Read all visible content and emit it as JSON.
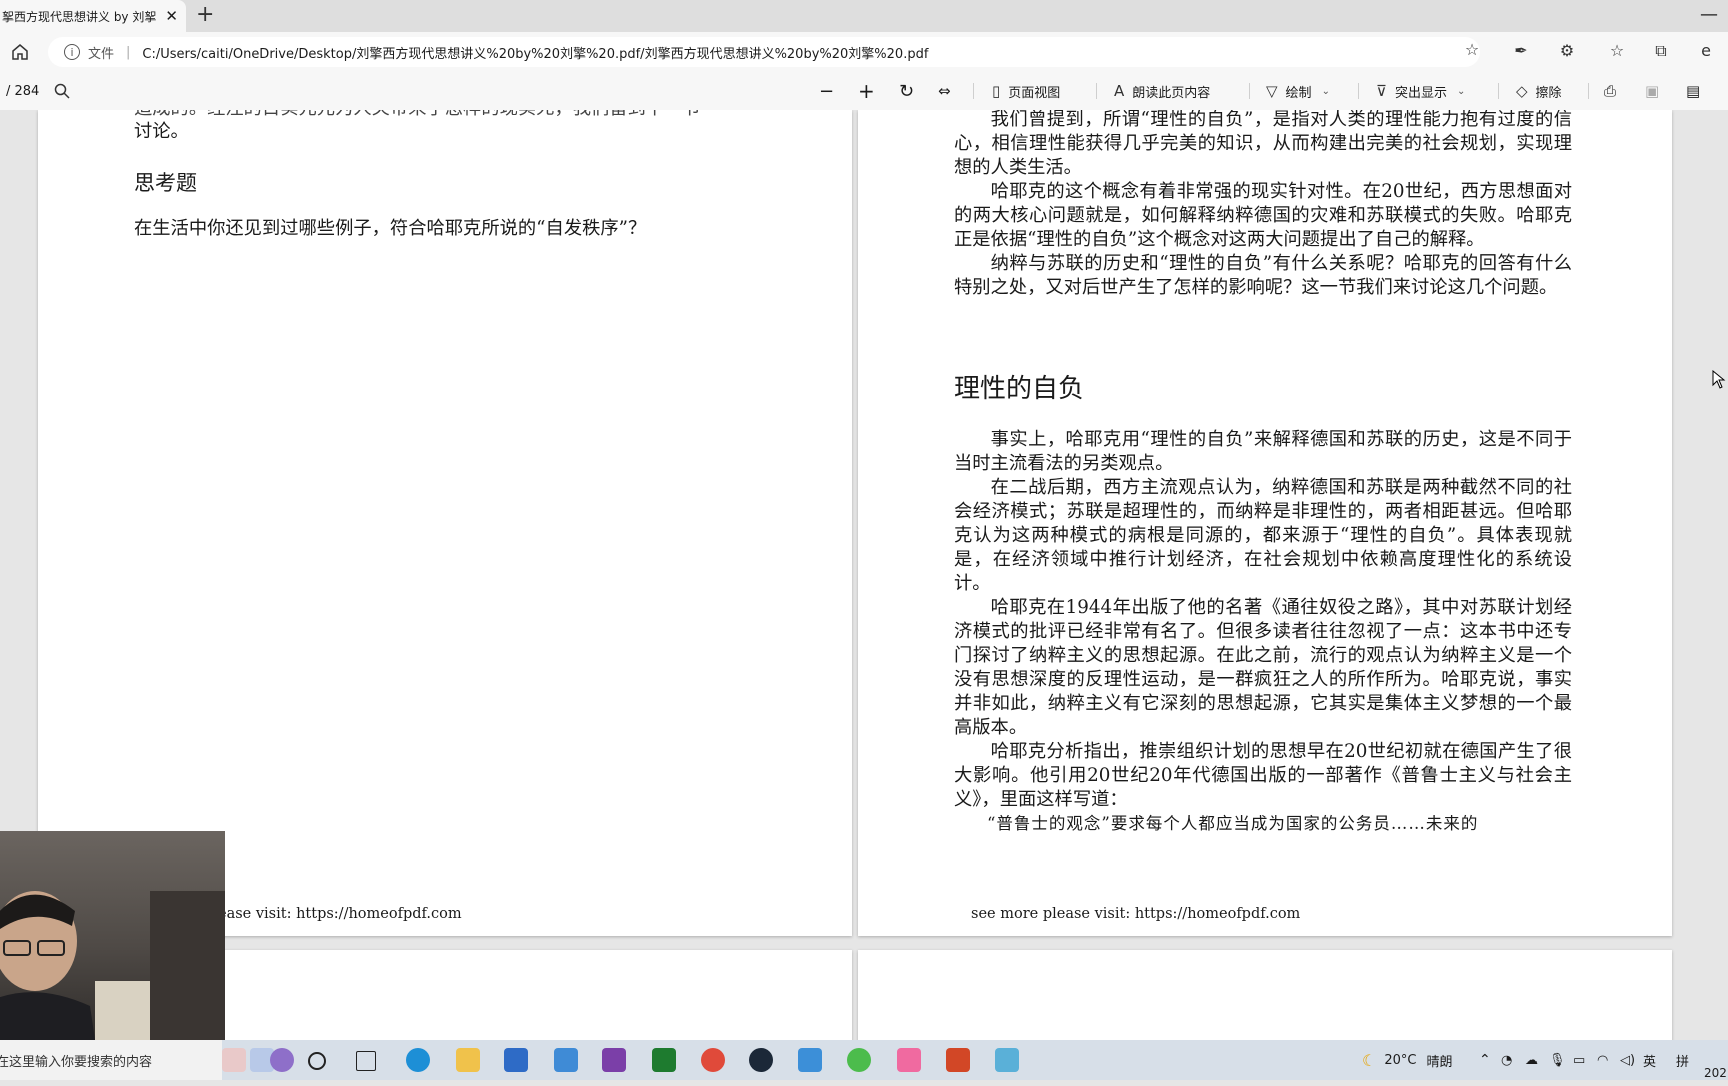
{
  "browser": {
    "tab_title": "挐西方现代思想讲义 by 刘挐",
    "tab_close": "✕",
    "new_tab": "+",
    "window_minimize": "—",
    "file_label": "文件",
    "url": "C:/Users/caiti/OneDrive/Desktop/刘擎西方现代思想讲义%20by%20刘擎%20.pdf/刘擎西方现代思想讲义%20by%20刘擎%20.pdf"
  },
  "pdf_toolbar": {
    "page_count": "/ 284",
    "page_view": "页面视图",
    "read_aloud": "朗读此页内容",
    "draw": "绘制",
    "highlight": "突出显示",
    "erase": "擦除"
  },
  "left_page": {
    "top_partial_line": "造成的。经注的目实元元为人关带来了怎样的现实死，我们留到下一节",
    "top_line": "讨论。",
    "heading": "思考题",
    "question": "在生活中你还见到过哪些例子，符合哈耶克所说的“自发秩序”？",
    "footer": "ease visit: https://homeofpdf.com"
  },
  "right_page": {
    "paragraphs_top": [
      "我们曾提到，所谓“理性的自负”，是指对人类的理性能力抱有过度的信心，相信理性能获得几乎完美的知识，从而构建出完美的社会规划，实现理想的人类生活。",
      "哈耶克的这个概念有着非常强的现实针对性。在20世纪，西方思想面对的两大核心问题就是，如何解释纳粹德国的灾难和苏联模式的失败。哈耶克正是依据“理性的自负”这个概念对这两大问题提出了自己的解释。",
      "纳粹与苏联的历史和“理性的自负”有什么关系呢？哈耶克的回答有什么特别之处，又对后世产生了怎样的影响呢？这一节我们来讨论这几个问题。"
    ],
    "heading": "理性的自负",
    "paragraphs_bottom": [
      "事实上，哈耶克用“理性的自负”来解释德国和苏联的历史，这是不同于当时主流看法的另类观点。",
      "在二战后期，西方主流观点认为，纳粹德国和苏联是两种截然不同的社会经济模式；苏联是超理性的，而纳粹是非理性的，两者相距甚远。但哈耶克认为这两种模式的病根是同源的，都来源于“理性的自负”。具体表现就是，在经济领域中推行计划经济，在社会规划中依赖高度理性化的系统设计。",
      "哈耶克在1944年出版了他的名著《通往奴役之路》，其中对苏联计划经济模式的批评已经非常有名了。但很多读者往往忽视了一点：这本书中还专门探讨了纳粹主义的思想起源。在此之前，流行的观点认为纳粹主义是一个没有思想深度的反理性运动，是一群疯狂之人的所作所为。哈耶克说，事实并非如此，纳粹主义有它深刻的思想起源，它其实是集体主义梦想的一个最高版本。",
      "哈耶克分析指出，推崇组织计划的思想早在20世纪初就在德国产生了很大影响。他引用20世纪20年代德国出版的一部著作《普鲁士主义与社会主义》，里面这样写道："
    ],
    "quote": "“普鲁士的观念”要求每个人都应当成为国家的公务员……未来的",
    "footer": "see more please visit: https://homeofpdf.com"
  },
  "taskbar": {
    "search_placeholder": "在这里输入你要搜索的内容",
    "weather_temp": "20°C",
    "weather_text": "晴朗",
    "ime": "英",
    "ime2": "拼",
    "clock_partial": "202"
  }
}
